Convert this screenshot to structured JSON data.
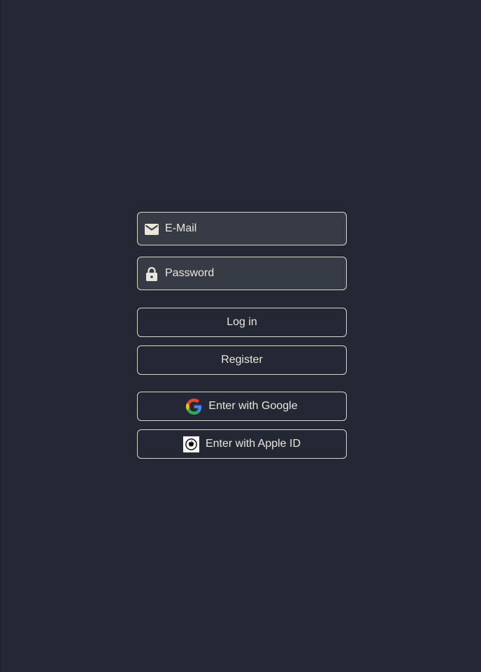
{
  "login": {
    "email": {
      "placeholder": "E-Mail",
      "value": "",
      "icon": "mail-icon"
    },
    "password": {
      "placeholder": "Password",
      "value": "",
      "icon": "lock-icon"
    },
    "login_label": "Log in",
    "register_label": "Register",
    "google_label": "Enter with Google",
    "apple_label": "Enter with Apple ID"
  },
  "colors": {
    "background": "#232834",
    "field_background": "#363b45",
    "border": "#d9d6cc",
    "text": "#e9e6dc"
  }
}
